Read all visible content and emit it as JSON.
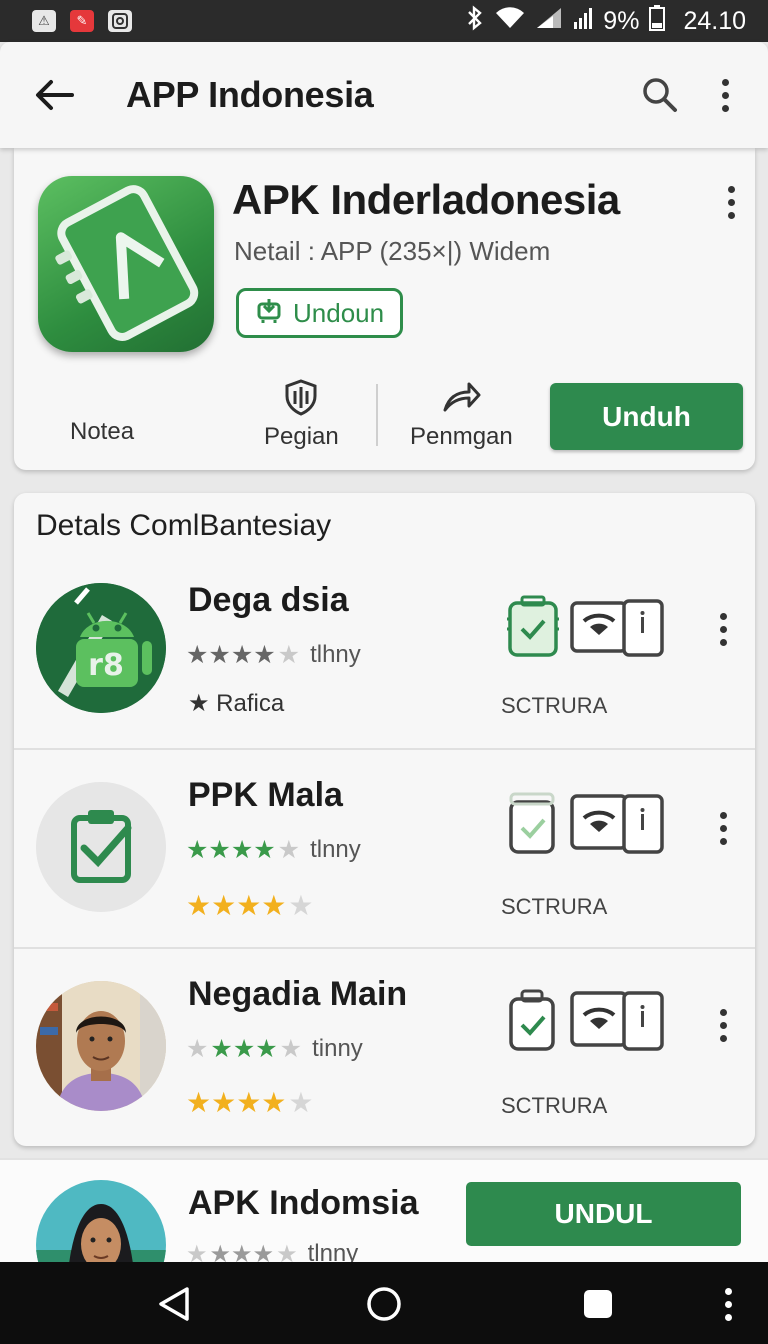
{
  "status_bar": {
    "battery": "9%",
    "time": "24.10",
    "left_icons": [
      "notification-icon",
      "app-notification-icon",
      "camera-notification-icon"
    ],
    "right_icons": [
      "bluetooth-icon",
      "wifi-icon",
      "signal-icon",
      "battery-icon"
    ]
  },
  "app_bar": {
    "title": "APP Indonesia",
    "icons": [
      "back-arrow-icon",
      "search-icon",
      "more-vert-icon"
    ]
  },
  "hero": {
    "title": "APK Inderladonesia",
    "subtitle": "Netail : APP (235×|) Widem",
    "badge_label": "Undoun",
    "actions": [
      {
        "label": "Notea",
        "icon": ""
      },
      {
        "label": "Pegian",
        "icon": "shield-icon"
      },
      {
        "label": "Penmgan",
        "icon": "share-icon"
      }
    ],
    "install_label": "Unduh"
  },
  "list": {
    "heading": "Detals ComlBantesiay",
    "items": [
      {
        "name": "Dega dsia",
        "rating_label": "tlhny",
        "meta": "★ Rafica",
        "category": "SCTRURA",
        "avatar": "android-logo"
      },
      {
        "name": "PPK Mala",
        "rating_label": "tlnny",
        "category": "SCTRURA",
        "avatar": "clipboard-check"
      },
      {
        "name": "Negadia Main",
        "rating_label": "tinny",
        "category": "SCTRURA",
        "avatar": "person-photo"
      }
    ]
  },
  "promo": {
    "title": "APK Indomsia",
    "rating_label": "tlnny",
    "button_label": "UNDUL"
  },
  "colors": {
    "accent_green": "#2e8a4e",
    "star_green": "#3a9a4a",
    "star_gold": "#f2b01e",
    "star_gray": "#777777"
  }
}
